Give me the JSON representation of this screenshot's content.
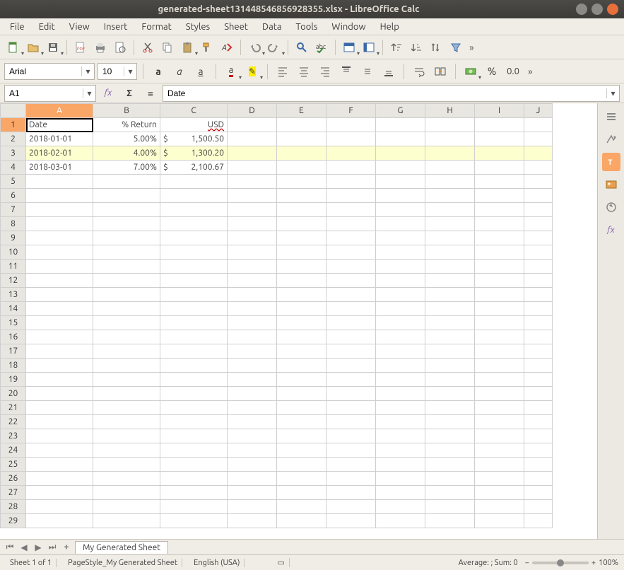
{
  "window": {
    "title": "generated-sheet131448546856928355.xlsx - LibreOffice Calc"
  },
  "menu": {
    "file": "File",
    "edit": "Edit",
    "view": "View",
    "insert": "Insert",
    "format": "Format",
    "styles": "Styles",
    "sheet": "Sheet",
    "data": "Data",
    "tools": "Tools",
    "window": "Window",
    "help": "Help"
  },
  "formatbar": {
    "font_name": "Arial",
    "font_size": "10",
    "percent_label": "%",
    "decimal_label": "0.0"
  },
  "cellref": {
    "name_box": "A1",
    "formula": "Date"
  },
  "columns": [
    "A",
    "B",
    "C",
    "D",
    "E",
    "F",
    "G",
    "H",
    "I",
    "J"
  ],
  "rows": [
    "1",
    "2",
    "3",
    "4",
    "5",
    "6",
    "7",
    "8",
    "9",
    "10",
    "11",
    "12",
    "13",
    "14",
    "15",
    "16",
    "17",
    "18",
    "19",
    "20",
    "21",
    "22",
    "23",
    "24",
    "25",
    "26",
    "27",
    "28",
    "29"
  ],
  "table": {
    "header": {
      "A": "Date",
      "B": "% Return",
      "C": "USD"
    },
    "data": [
      {
        "A": "2018-01-01",
        "B": "5.00%",
        "C_sym": "$",
        "C_val": "1,500.50"
      },
      {
        "A": "2018-02-01",
        "B": "4.00%",
        "C_sym": "$",
        "C_val": "1,300.20"
      },
      {
        "A": "2018-03-01",
        "B": "7.00%",
        "C_sym": "$",
        "C_val": "2,100.67"
      }
    ]
  },
  "tabs": {
    "sheet_name": "My Generated Sheet"
  },
  "status": {
    "sheet": "Sheet 1 of 1",
    "style": "PageStyle_My Generated Sheet",
    "lang": "English (USA)",
    "summary": "Average: ; Sum: 0",
    "zoom": "100%"
  },
  "icons": {
    "more": "»",
    "minus": "−",
    "plus": "+"
  }
}
